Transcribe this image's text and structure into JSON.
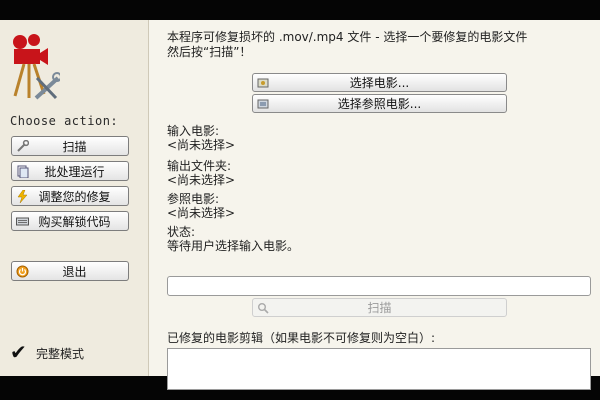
{
  "sidebar": {
    "choose_label": "Choose action:",
    "buttons": [
      {
        "label": "扫描",
        "icon": "wrench-icon"
      },
      {
        "label": "批处理运行",
        "icon": "batch-icon"
      },
      {
        "label": "调整您的修复",
        "icon": "lightning-icon"
      },
      {
        "label": "购买解锁代码",
        "icon": "keyboard-icon"
      },
      {
        "label": "退出",
        "icon": "exit-icon"
      }
    ],
    "full_mode_check": "✔",
    "full_mode_label": "完整模式"
  },
  "main": {
    "intro_line1": "本程序可修复损坏的 .mov/.mp4 文件 - 选择一个要修复的电影文件",
    "intro_line2": "然后按“扫描”！",
    "select_movie_button": "选择电影...",
    "select_reference_button": "选择参照电影...",
    "input_movie_label": "输入电影:",
    "input_movie_value": "<尚未选择>",
    "output_folder_label": "输出文件夹:",
    "output_folder_value": "<尚未选择>",
    "reference_movie_label": "参照电影:",
    "reference_movie_value": "<尚未选择>",
    "status_label": "状态:",
    "status_value": "等待用户选择输入电影。",
    "scan_button": "扫描",
    "clips_label": "已修复的电影剪辑（如果电影不可修复则为空白）:"
  },
  "colors": {
    "sidebar_bg": "#efebdf",
    "main_bg": "#f6f4ec",
    "logo_red": "#c8141a"
  }
}
